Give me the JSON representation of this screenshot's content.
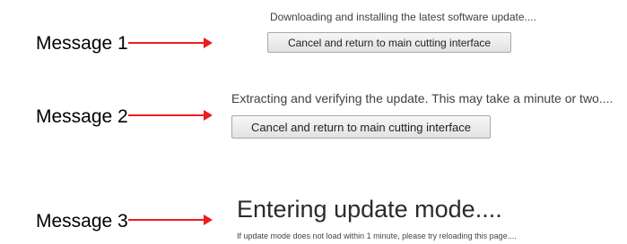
{
  "message1": {
    "label": "Message 1",
    "status": "Downloading and installing the latest software update....",
    "button_label": "Cancel and return to main cutting interface"
  },
  "message2": {
    "label": "Message 2",
    "status": "Extracting and verifying the update. This may take a minute or two....",
    "button_label": "Cancel and return to main cutting interface"
  },
  "message3": {
    "label": "Message 3",
    "heading": "Entering update mode....",
    "note": "If update mode does not load within 1 minute, please try reloading this page...."
  },
  "colors": {
    "arrow": "#ee1c1c"
  }
}
